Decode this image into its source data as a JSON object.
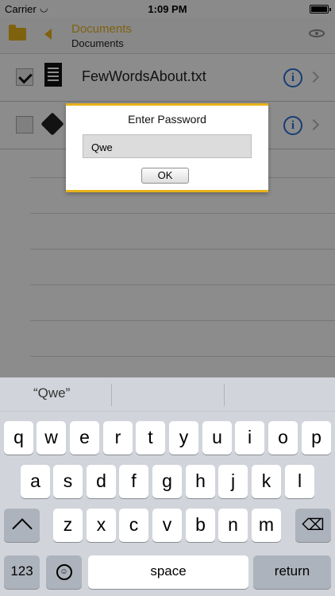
{
  "status_bar": {
    "carrier": "Carrier",
    "time": "1:09 PM",
    "wifi_icon": "wifi-icon",
    "battery_icon": "battery-icon"
  },
  "nav_bar": {
    "title": "Documents",
    "subtitle": "Documents",
    "accent_color": "#e7b21b",
    "icons": [
      "folder-icon",
      "back-icon",
      "eye-icon"
    ]
  },
  "files": [
    {
      "name": "FewWordsAbout.txt",
      "selected": true,
      "icon": "text-file-icon"
    },
    {
      "name": "",
      "selected": false,
      "icon": "cube-icon"
    }
  ],
  "dialog": {
    "title": "Enter Password",
    "password_value": "Qwe",
    "ok_label": "OK"
  },
  "keyboard": {
    "suggestion": "“Qwe”",
    "row1": [
      "q",
      "w",
      "e",
      "r",
      "t",
      "y",
      "u",
      "i",
      "o",
      "p"
    ],
    "row2": [
      "a",
      "s",
      "d",
      "f",
      "g",
      "h",
      "j",
      "k",
      "l"
    ],
    "row3": [
      "z",
      "x",
      "c",
      "v",
      "b",
      "n",
      "m"
    ],
    "numbers_label": "123",
    "space_label": "space",
    "return_label": "return"
  }
}
